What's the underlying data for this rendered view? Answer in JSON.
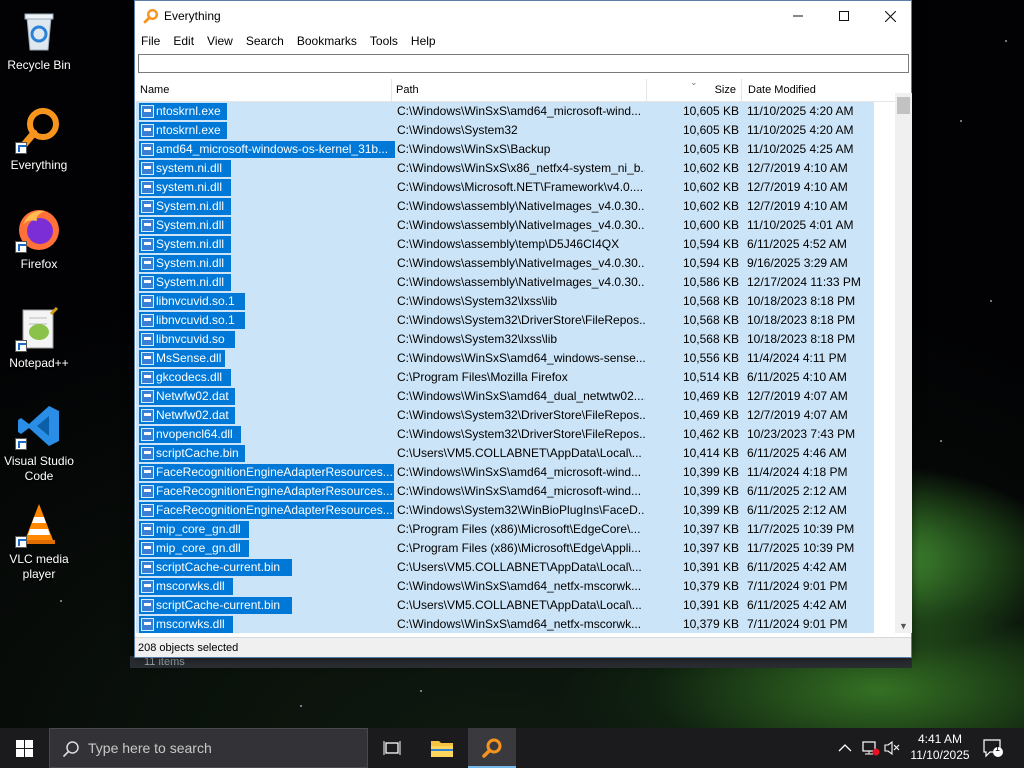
{
  "desktop": {
    "icons": [
      {
        "label": "Recycle Bin"
      },
      {
        "label": "Everything"
      },
      {
        "label": "Firefox"
      },
      {
        "label": "Notepad++"
      },
      {
        "label": "Visual Studio Code"
      },
      {
        "label": "VLC media player"
      }
    ]
  },
  "window": {
    "title": "Everything",
    "menu": [
      "File",
      "Edit",
      "View",
      "Search",
      "Bookmarks",
      "Tools",
      "Help"
    ],
    "search_value": "",
    "columns": {
      "name": "Name",
      "path": "Path",
      "size": "Size",
      "date": "Date Modified"
    },
    "rows": [
      {
        "name": "ntoskrnl.exe",
        "path": "C:\\Windows\\WinSxS\\amd64_microsoft-wind...",
        "size": "10,605 KB",
        "date": "11/10/2025 4:20 AM"
      },
      {
        "name": "ntoskrnl.exe",
        "path": "C:\\Windows\\System32",
        "size": "10,605 KB",
        "date": "11/10/2025 4:20 AM"
      },
      {
        "name": "amd64_microsoft-windows-os-kernel_31b...",
        "path": "C:\\Windows\\WinSxS\\Backup",
        "size": "10,605 KB",
        "date": "11/10/2025 4:25 AM"
      },
      {
        "name": "system.ni.dll",
        "path": "C:\\Windows\\WinSxS\\x86_netfx4-system_ni_b...",
        "size": "10,602 KB",
        "date": "12/7/2019 4:10 AM"
      },
      {
        "name": "system.ni.dll",
        "path": "C:\\Windows\\Microsoft.NET\\Framework\\v4.0....",
        "size": "10,602 KB",
        "date": "12/7/2019 4:10 AM"
      },
      {
        "name": "System.ni.dll",
        "path": "C:\\Windows\\assembly\\NativeImages_v4.0.30...",
        "size": "10,602 KB",
        "date": "12/7/2019 4:10 AM"
      },
      {
        "name": "System.ni.dll",
        "path": "C:\\Windows\\assembly\\NativeImages_v4.0.30...",
        "size": "10,600 KB",
        "date": "11/10/2025 4:01 AM"
      },
      {
        "name": "System.ni.dll",
        "path": "C:\\Windows\\assembly\\temp\\D5J46CI4QX",
        "size": "10,594 KB",
        "date": "6/11/2025 4:52 AM"
      },
      {
        "name": "System.ni.dll",
        "path": "C:\\Windows\\assembly\\NativeImages_v4.0.30...",
        "size": "10,594 KB",
        "date": "9/16/2025 3:29 AM"
      },
      {
        "name": "System.ni.dll",
        "path": "C:\\Windows\\assembly\\NativeImages_v4.0.30...",
        "size": "10,586 KB",
        "date": "12/17/2024 11:33 PM"
      },
      {
        "name": "libnvcuvid.so.1",
        "path": "C:\\Windows\\System32\\lxss\\lib",
        "size": "10,568 KB",
        "date": "10/18/2023 8:18 PM"
      },
      {
        "name": "libnvcuvid.so.1",
        "path": "C:\\Windows\\System32\\DriverStore\\FileRepos...",
        "size": "10,568 KB",
        "date": "10/18/2023 8:18 PM"
      },
      {
        "name": "libnvcuvid.so",
        "path": "C:\\Windows\\System32\\lxss\\lib",
        "size": "10,568 KB",
        "date": "10/18/2023 8:18 PM"
      },
      {
        "name": "MsSense.dll",
        "path": "C:\\Windows\\WinSxS\\amd64_windows-sense...",
        "size": "10,556 KB",
        "date": "11/4/2024 4:11 PM"
      },
      {
        "name": "gkcodecs.dll",
        "path": "C:\\Program Files\\Mozilla Firefox",
        "size": "10,514 KB",
        "date": "6/11/2025 4:10 AM"
      },
      {
        "name": "Netwfw02.dat",
        "path": "C:\\Windows\\WinSxS\\amd64_dual_netwtw02....",
        "size": "10,469 KB",
        "date": "12/7/2019 4:07 AM"
      },
      {
        "name": "Netwfw02.dat",
        "path": "C:\\Windows\\System32\\DriverStore\\FileRepos...",
        "size": "10,469 KB",
        "date": "12/7/2019 4:07 AM"
      },
      {
        "name": "nvopencl64.dll",
        "path": "C:\\Windows\\System32\\DriverStore\\FileRepos...",
        "size": "10,462 KB",
        "date": "10/23/2023 7:43 PM"
      },
      {
        "name": "scriptCache.bin",
        "path": "C:\\Users\\VM5.COLLABNET\\AppData\\Local\\...",
        "size": "10,414 KB",
        "date": "6/11/2025 4:46 AM"
      },
      {
        "name": "FaceRecognitionEngineAdapterResources...",
        "path": "C:\\Windows\\WinSxS\\amd64_microsoft-wind...",
        "size": "10,399 KB",
        "date": "11/4/2024 4:18 PM"
      },
      {
        "name": "FaceRecognitionEngineAdapterResources...",
        "path": "C:\\Windows\\WinSxS\\amd64_microsoft-wind...",
        "size": "10,399 KB",
        "date": "6/11/2025 2:12 AM"
      },
      {
        "name": "FaceRecognitionEngineAdapterResources...",
        "path": "C:\\Windows\\System32\\WinBioPlugIns\\FaceD...",
        "size": "10,399 KB",
        "date": "6/11/2025 2:12 AM"
      },
      {
        "name": "mip_core_gn.dll",
        "path": "C:\\Program Files (x86)\\Microsoft\\EdgeCore\\...",
        "size": "10,397 KB",
        "date": "11/7/2025 10:39 PM"
      },
      {
        "name": "mip_core_gn.dll",
        "path": "C:\\Program Files (x86)\\Microsoft\\Edge\\Appli...",
        "size": "10,397 KB",
        "date": "11/7/2025 10:39 PM"
      },
      {
        "name": "scriptCache-current.bin",
        "path": "C:\\Users\\VM5.COLLABNET\\AppData\\Local\\...",
        "size": "10,391 KB",
        "date": "6/11/2025 4:42 AM"
      },
      {
        "name": "mscorwks.dll",
        "path": "C:\\Windows\\WinSxS\\amd64_netfx-mscorwk...",
        "size": "10,379 KB",
        "date": "7/11/2024 9:01 PM"
      },
      {
        "name": "scriptCache-current.bin",
        "path": "C:\\Users\\VM5.COLLABNET\\AppData\\Local\\...",
        "size": "10,391 KB",
        "date": "6/11/2025 4:42 AM"
      },
      {
        "name": "mscorwks.dll",
        "path": "C:\\Windows\\WinSxS\\amd64_netfx-mscorwk...",
        "size": "10,379 KB",
        "date": "7/11/2024 9:01 PM"
      }
    ],
    "status": "208 objects selected",
    "behind_status": "11 items"
  },
  "taskbar": {
    "search_placeholder": "Type here to search",
    "time": "4:41 AM",
    "date": "11/10/2025",
    "notification_count": "1"
  },
  "colors": {
    "selection": "#cce4f7",
    "name_highlight": "#0078d7",
    "taskbar": "#1b1b1e",
    "accent": "#76b9ed"
  }
}
